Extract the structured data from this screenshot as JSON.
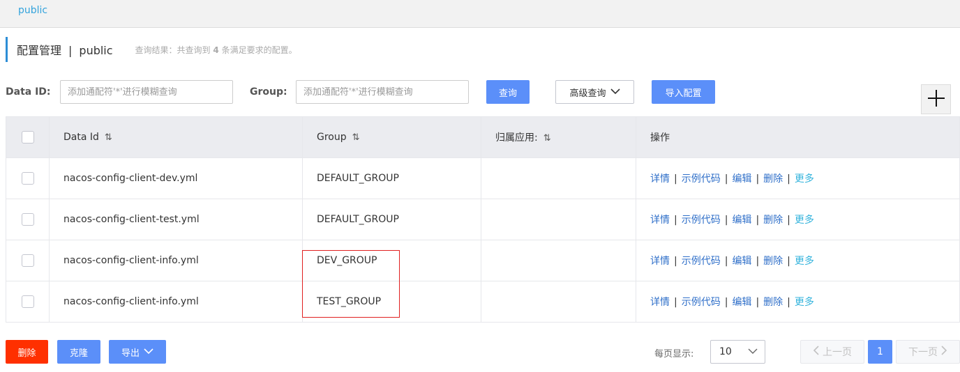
{
  "namespace": {
    "current": "public"
  },
  "header": {
    "title": "配置管理",
    "separator": "|",
    "namespace": "public",
    "result_prefix": "查询结果：共查询到",
    "result_count": "4",
    "result_suffix": "条满足要求的配置。"
  },
  "search": {
    "dataid_label": "Data ID:",
    "dataid_placeholder": "添加通配符'*'进行模糊查询",
    "group_label": "Group:",
    "group_placeholder": "添加通配符'*'进行模糊查询",
    "query_button": "查询",
    "advanced_button": "高级查询",
    "import_button": "导入配置"
  },
  "table": {
    "headers": {
      "data_id": "Data Id",
      "group": "Group",
      "app": "归属应用:",
      "ops": "操作"
    },
    "rows": [
      {
        "data_id": "nacos-config-client-dev.yml",
        "group": "DEFAULT_GROUP",
        "app": ""
      },
      {
        "data_id": "nacos-config-client-test.yml",
        "group": "DEFAULT_GROUP",
        "app": ""
      },
      {
        "data_id": "nacos-config-client-info.yml",
        "group": "DEV_GROUP",
        "app": ""
      },
      {
        "data_id": "nacos-config-client-info.yml",
        "group": "TEST_GROUP",
        "app": ""
      }
    ],
    "ops": {
      "detail": "详情",
      "sample": "示例代码",
      "edit": "编辑",
      "delete": "删除",
      "more": "更多",
      "sep": "|"
    }
  },
  "footer": {
    "delete_button": "删除",
    "clone_button": "克隆",
    "export_button": "导出",
    "page_size_label": "每页显示:",
    "page_size": "10",
    "prev": "上一页",
    "current_page": "1",
    "next": "下一页"
  },
  "colors": {
    "primary": "#5b8ff9",
    "danger": "#ff3000",
    "link": "#2f6fc9",
    "accent_bar": "#2c8dd6",
    "highlight": "#e02020"
  }
}
